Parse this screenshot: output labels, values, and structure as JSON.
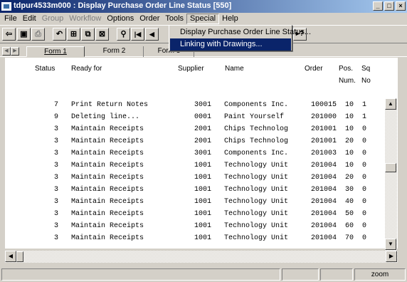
{
  "window": {
    "title": "tdpur4533m000 : Display Purchase Order Line Status [550]",
    "controls": [
      "_",
      "□",
      "×"
    ]
  },
  "menubar": {
    "items": [
      {
        "label": "File",
        "disabled": false
      },
      {
        "label": "Edit",
        "disabled": false
      },
      {
        "label": "Group",
        "disabled": true
      },
      {
        "label": "Workflow",
        "disabled": true
      },
      {
        "label": "Options",
        "disabled": false
      },
      {
        "label": "Order",
        "disabled": false
      },
      {
        "label": "Tools",
        "disabled": false
      },
      {
        "label": "Special",
        "disabled": false,
        "active": true
      },
      {
        "label": "Help",
        "disabled": false
      }
    ]
  },
  "special_menu": {
    "items": [
      {
        "label": "Display Purchase Order Line Status...",
        "selected": false
      },
      {
        "label": "Linking with Drawings...",
        "selected": true
      }
    ]
  },
  "toolbar": {
    "buttons": [
      {
        "name": "exit-icon",
        "glyph": "⇦"
      },
      {
        "name": "save-icon",
        "glyph": "▣"
      },
      {
        "name": "print-icon",
        "glyph": "⎙"
      },
      {
        "name": "undo-icon",
        "glyph": "↶"
      },
      {
        "name": "insert-icon",
        "glyph": "⊞"
      },
      {
        "name": "copy-icon",
        "glyph": "⧉"
      },
      {
        "name": "delete-icon",
        "glyph": "⊠"
      },
      {
        "name": "find-icon",
        "glyph": "⚲"
      },
      {
        "name": "first-record-icon",
        "glyph": "|◀"
      },
      {
        "name": "previous-record-icon",
        "glyph": "◀"
      },
      {
        "name": "help-icon",
        "glyph": "▸?"
      }
    ]
  },
  "tabs": [
    {
      "label": "Form 1",
      "active": true
    },
    {
      "label": "Form 2",
      "active": false
    },
    {
      "label": "Form 3",
      "active": false
    }
  ],
  "table": {
    "headers": {
      "status": "Status",
      "ready_for": "Ready for",
      "supplier": "Supplier",
      "name": "Name",
      "order": "Order",
      "pos_num": [
        "Pos.",
        "Num."
      ],
      "seq_no": [
        "Sq",
        "No"
      ]
    },
    "rows": [
      {
        "status": "7",
        "ready_for": "Print Return Notes",
        "supplier": "3001",
        "name": "Components Inc.",
        "order": "100015",
        "pos": "10",
        "seq": "1"
      },
      {
        "status": "9",
        "ready_for": "Deleting line...",
        "supplier": "0001",
        "name": "Paint Yourself",
        "order": "201000",
        "pos": "10",
        "seq": "1"
      },
      {
        "status": "3",
        "ready_for": "Maintain Receipts",
        "supplier": "2001",
        "name": "Chips Technolog",
        "order": "201001",
        "pos": "10",
        "seq": "0"
      },
      {
        "status": "3",
        "ready_for": "Maintain Receipts",
        "supplier": "2001",
        "name": "Chips Technolog",
        "order": "201001",
        "pos": "20",
        "seq": "0"
      },
      {
        "status": "3",
        "ready_for": "Maintain Receipts",
        "supplier": "3001",
        "name": "Components Inc.",
        "order": "201003",
        "pos": "10",
        "seq": "0"
      },
      {
        "status": "3",
        "ready_for": "Maintain Receipts",
        "supplier": "1001",
        "name": "Technology Unit",
        "order": "201004",
        "pos": "10",
        "seq": "0"
      },
      {
        "status": "3",
        "ready_for": "Maintain Receipts",
        "supplier": "1001",
        "name": "Technology Unit",
        "order": "201004",
        "pos": "20",
        "seq": "0"
      },
      {
        "status": "3",
        "ready_for": "Maintain Receipts",
        "supplier": "1001",
        "name": "Technology Unit",
        "order": "201004",
        "pos": "30",
        "seq": "0"
      },
      {
        "status": "3",
        "ready_for": "Maintain Receipts",
        "supplier": "1001",
        "name": "Technology Unit",
        "order": "201004",
        "pos": "40",
        "seq": "0"
      },
      {
        "status": "3",
        "ready_for": "Maintain Receipts",
        "supplier": "1001",
        "name": "Technology Unit",
        "order": "201004",
        "pos": "50",
        "seq": "0"
      },
      {
        "status": "3",
        "ready_for": "Maintain Receipts",
        "supplier": "1001",
        "name": "Technology Unit",
        "order": "201004",
        "pos": "60",
        "seq": "0"
      },
      {
        "status": "3",
        "ready_for": "Maintain Receipts",
        "supplier": "1001",
        "name": "Technology Unit",
        "order": "201004",
        "pos": "70",
        "seq": "0"
      }
    ]
  },
  "statusbar": {
    "zoom_label": "zoom"
  },
  "colors": {
    "title_active": "#0a246a",
    "menu_highlight": "#0a246a",
    "face": "#d4d0c8"
  }
}
